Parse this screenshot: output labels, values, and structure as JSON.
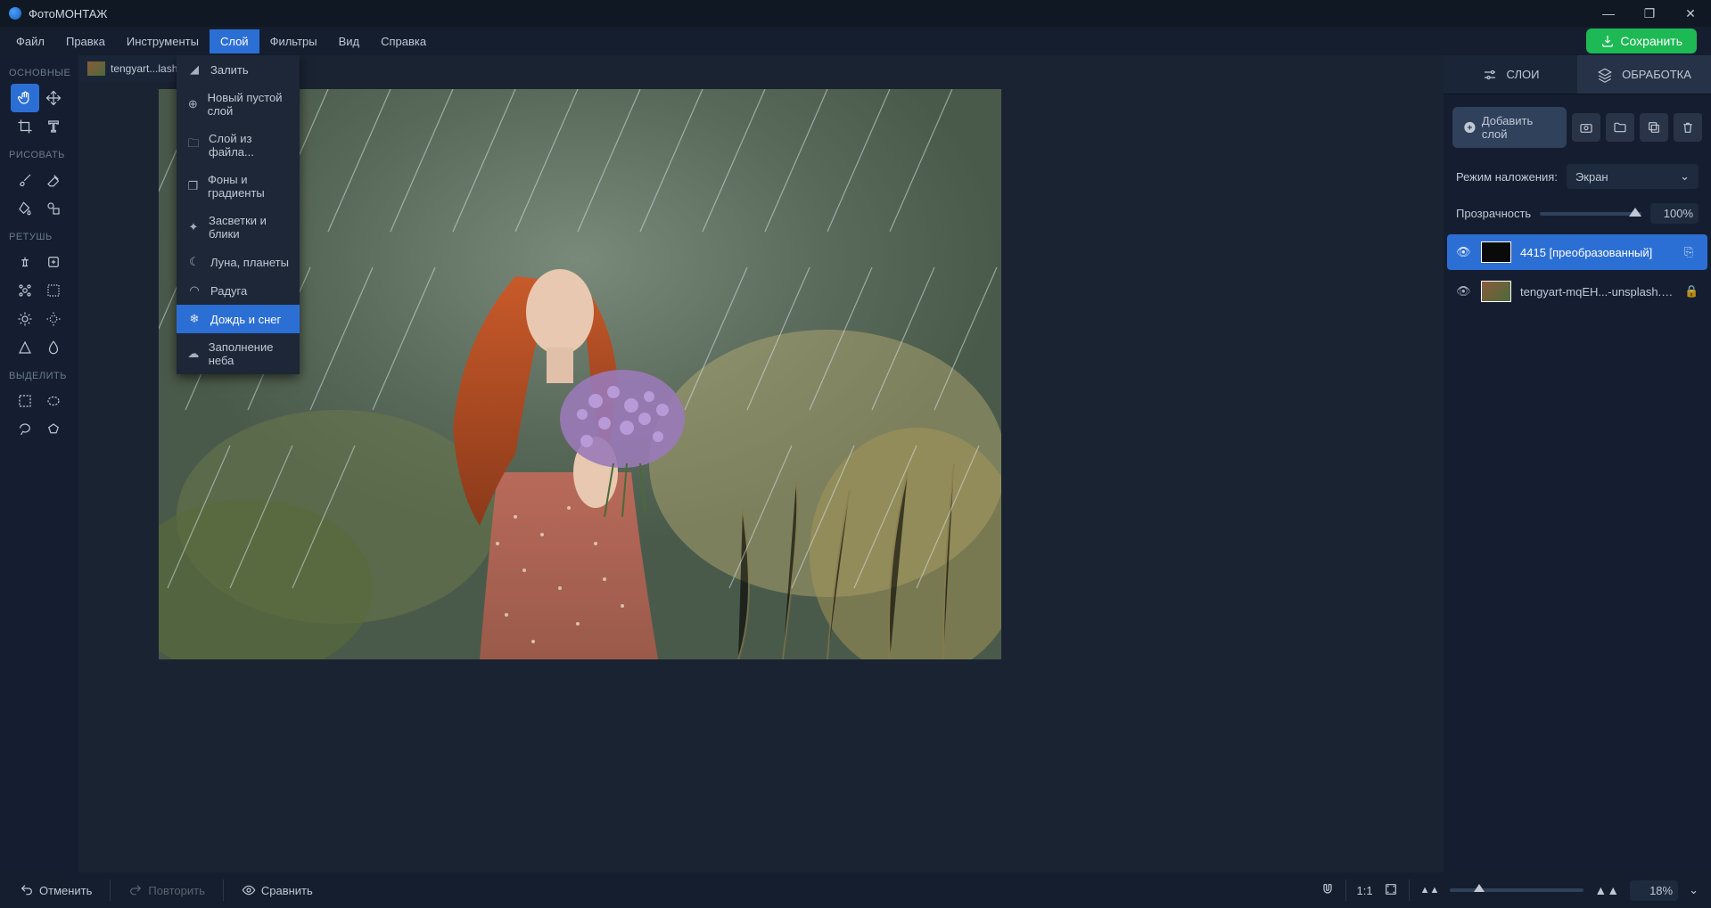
{
  "titlebar": {
    "app_name": "ФотоМОНТАЖ"
  },
  "menubar": {
    "items": [
      "Файл",
      "Правка",
      "Инструменты",
      "Слой",
      "Фильтры",
      "Вид",
      "Справка"
    ],
    "active_index": 3,
    "save_label": "Сохранить"
  },
  "tab": {
    "label": "tengyart...lash"
  },
  "dropdown": {
    "items": [
      {
        "label": "Залить",
        "icon": "paint-bucket-icon"
      },
      {
        "label": "Новый пустой слой",
        "icon": "plus-circle-icon"
      },
      {
        "label": "Слой из файла...",
        "icon": "folder-icon"
      },
      {
        "label": "Фоны и градиенты",
        "icon": "layers-icon"
      },
      {
        "label": "Засветки и блики",
        "icon": "sparkle-icon"
      },
      {
        "label": "Луна, планеты",
        "icon": "moon-icon"
      },
      {
        "label": "Радуга",
        "icon": "rainbow-icon"
      },
      {
        "label": "Дождь и снег",
        "icon": "snowflake-icon",
        "highlight": true
      },
      {
        "label": "Заполнение неба",
        "icon": "cloud-icon"
      }
    ]
  },
  "toolbar": {
    "sections": [
      {
        "label": "ОСНОВНЫЕ",
        "tools": [
          "hand",
          "move",
          "crop",
          "text"
        ],
        "active": 0
      },
      {
        "label": "РИСОВАТЬ",
        "tools": [
          "brush",
          "eraser",
          "paint-bucket",
          "shapes"
        ]
      },
      {
        "label": "РЕТУШЬ",
        "tools": [
          "clone-stamp",
          "patch",
          "heal-brush",
          "remove-obj",
          "bright",
          "bright2",
          "triangle",
          "droplet"
        ]
      },
      {
        "label": "ВЫДЕЛИТЬ",
        "tools": [
          "rect-select",
          "ellipse-select",
          "lasso",
          "poly-lasso"
        ]
      }
    ]
  },
  "right_panel": {
    "tabs": [
      "СЛОИ",
      "ОБРАБОТКА"
    ],
    "active_tab": 1,
    "add_layer_label": "Добавить слой",
    "blend_label": "Режим наложения:",
    "blend_mode": "Экран",
    "opacity_label": "Прозрачность",
    "opacity_value": "100%",
    "layers": [
      {
        "name": "4415 [преобразованный]",
        "selected": true,
        "lock": "link"
      },
      {
        "name": "tengyart-mqEH...-unsplash.jpg",
        "selected": false,
        "lock": "lock"
      }
    ]
  },
  "bottombar": {
    "undo": "Отменить",
    "redo": "Повторить",
    "compare": "Сравнить",
    "ratio": "1:1",
    "zoom": "18%"
  }
}
